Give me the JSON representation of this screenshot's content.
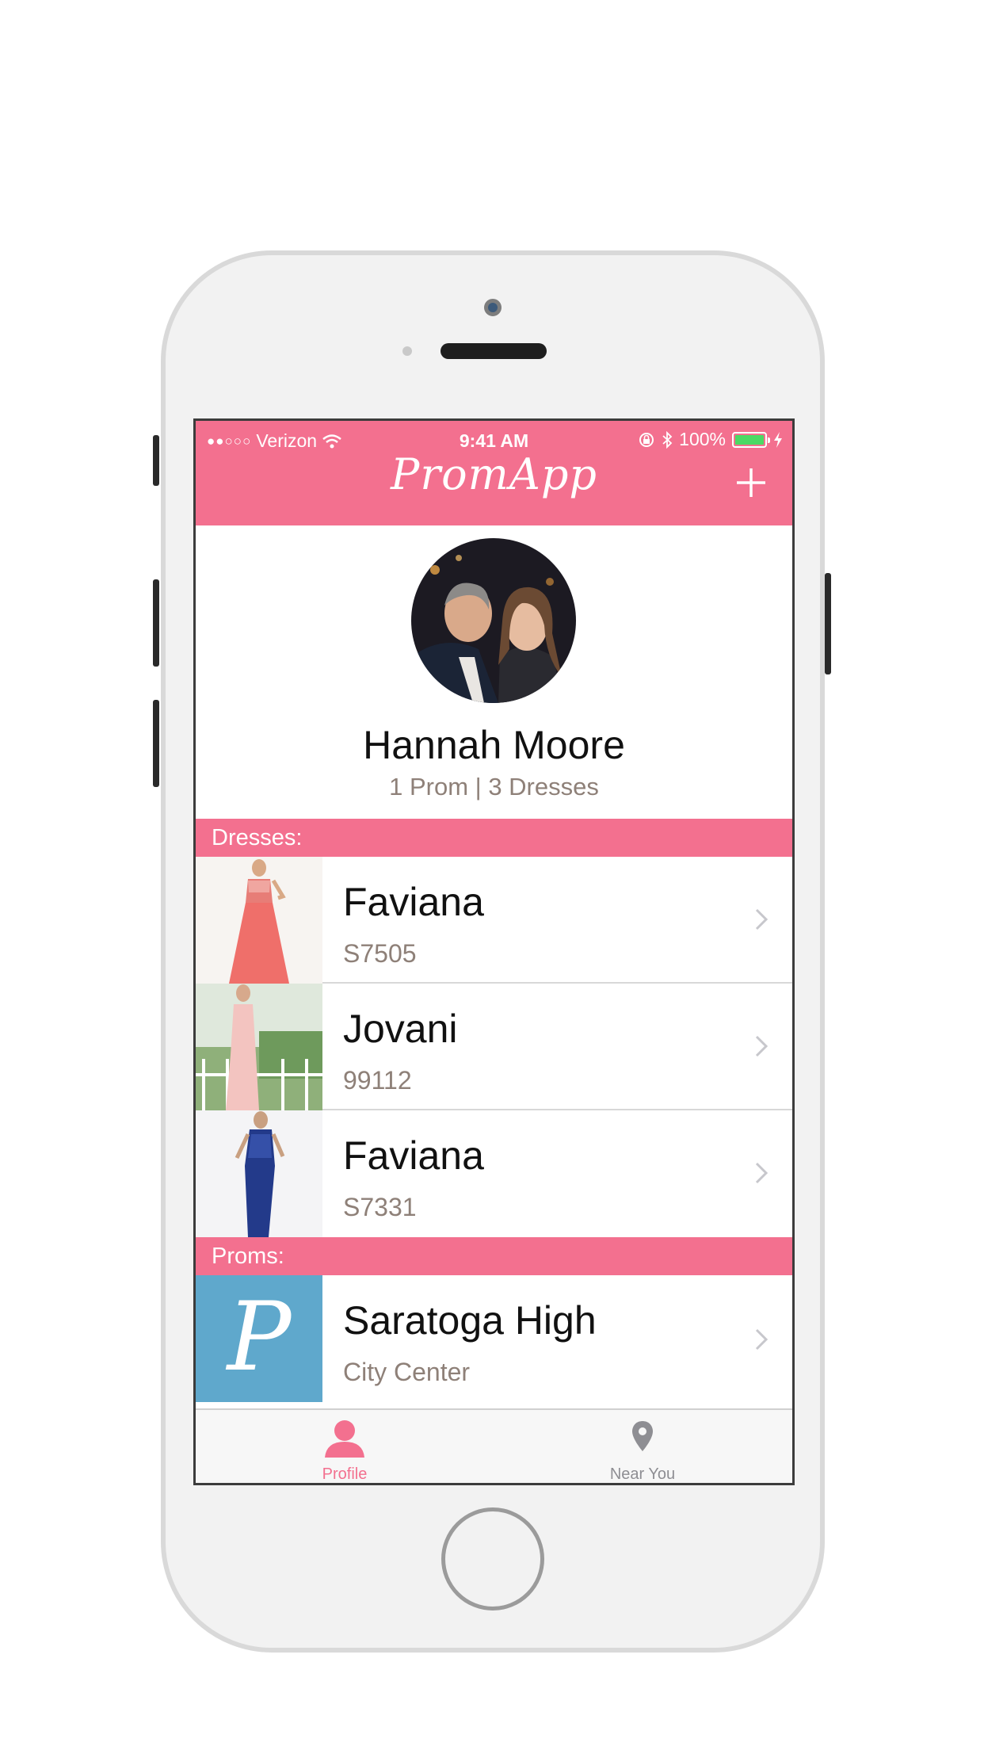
{
  "colors": {
    "brand_pink": "#f3708f",
    "secondary_text": "#8e8078",
    "battery": "#4cd964",
    "prom_tile": "#5fa8cc"
  },
  "status_bar": {
    "carrier": "Verizon",
    "time": "9:41 AM",
    "battery": "100%"
  },
  "nav": {
    "title": "PromApp",
    "add_icon": "plus-icon"
  },
  "profile": {
    "name": "Hannah Moore",
    "stats": "1 Prom | 3 Dresses"
  },
  "dresses_header": "Dresses:",
  "dresses": [
    {
      "title": "Faviana",
      "subtitle": "S7505",
      "dress_color": "#ef6f6a"
    },
    {
      "title": "Jovani",
      "subtitle": "99112",
      "dress_color": "#f3c4c0"
    },
    {
      "title": "Faviana",
      "subtitle": "S7331",
      "dress_color": "#233a8a"
    }
  ],
  "proms_header": "Proms:",
  "proms": [
    {
      "title": "Saratoga High",
      "subtitle": "City Center",
      "tile_letter": "P"
    }
  ],
  "tabbar": {
    "tabs": [
      {
        "label": "Profile",
        "icon": "person-icon",
        "active": true
      },
      {
        "label": "Near You",
        "icon": "location-pin-icon",
        "active": false
      }
    ]
  }
}
